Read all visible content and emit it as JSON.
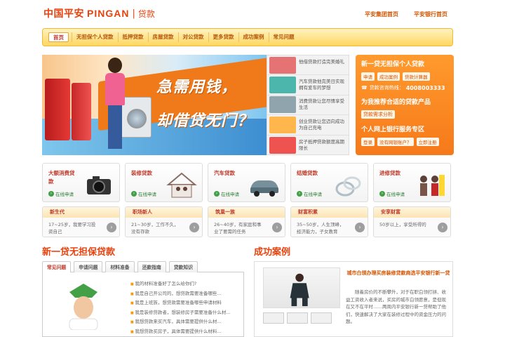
{
  "header": {
    "logo_cn": "中国平安",
    "logo_en": "PINGAN",
    "logo_sep": "|",
    "logo_sub": "贷款",
    "links": [
      "平安集团首页",
      "平安银行首页"
    ]
  },
  "nav": {
    "items": [
      "首页",
      "无担保个人贷款",
      "抵押贷款",
      "房屋贷款",
      "对公贷款",
      "更多贷款",
      "成功案例",
      "常见问题"
    ]
  },
  "banner": {
    "line1": "急需用钱，",
    "line2": "却借贷无门？"
  },
  "thumbs": [
    {
      "text": "他借贷款打造完美婚礼",
      "color": "#e57373"
    },
    {
      "text": "汽车贷款他完美日实现拥有爱车的梦想",
      "color": "#4db6ac"
    },
    {
      "text": "消费贷款让您尽情享受生活",
      "color": "#90a4ae"
    },
    {
      "text": "创业贷款让您迈向成功为自己充电",
      "color": "#ffb74d"
    },
    {
      "text": "房子抵押贷款额度高期限长",
      "color": "#ef5350"
    }
  ],
  "right_panel": {
    "title": "新一贷无担保个人贷款",
    "links": [
      "申请",
      "成功案例",
      "贷款计算器"
    ],
    "phone_label": "贷款咨询热线：",
    "phone": "4008003333",
    "recommend": "为我推荐合适的贷款产品",
    "recommend_link": "贷款需求分析",
    "bank_title": "个人网上银行服务专区",
    "bank_links": [
      "登录",
      "没有网银账户？",
      "立即注册"
    ]
  },
  "cards": [
    {
      "title": "大额消费贷款",
      "apply": "在线申请",
      "color": "#424242"
    },
    {
      "title": "装修贷款",
      "apply": "在线申请",
      "color": "#8d6e63"
    },
    {
      "title": "汽车贷款",
      "apply": "在线申请",
      "color": "#607d8b"
    },
    {
      "title": "结婚贷款",
      "apply": "在线申请",
      "color": "#b0bec5"
    },
    {
      "title": "进修贷款",
      "apply": "在线申请",
      "color": "#5d4037"
    }
  ],
  "segments": [
    {
      "title": "新生代",
      "text": "17~25岁，我要学习投资自己"
    },
    {
      "title": "职场新人",
      "text": "21~30岁，工作不久，没有存款"
    },
    {
      "title": "筑巢一族",
      "text": "26~40岁，有家庭和事业了要需的任务"
    },
    {
      "title": "财富积累",
      "text": "35~50岁，人生顶峰，经济能力，子女教育"
    },
    {
      "title": "安享财富",
      "text": "50岁以上，享受所得的"
    }
  ],
  "loan_section": {
    "title": "新一贷无担保贷款",
    "tabs": [
      "常见问题",
      "申请问题",
      "材料准备",
      "还款指南",
      "贷款知识"
    ],
    "faqs": [
      "我的材料准备好了怎么给你们?",
      "我是自己开公司的，想贷款需要准备哪些...",
      "我是上班族，想贷款需要准备哪些申请材料",
      "我是装修贷款者，想装修房子需要准备什么材...",
      "我想贷款来买汽车，具体需要提供什么材...",
      "我想贷款买房子，具体需要提供什么材料..."
    ]
  },
  "case_section": {
    "title": "成功案例",
    "case_title": "城市白领办理买房装修贷款商选平安银行新一贷",
    "case_text": "随着房价的不断攀升，对于在职白领打拼、收益工资收入者来说，买房的城市白领愿意，是但现在又不在平时……两周内平安银行新一贷帮助了他们，快速解决了大家在装修过程中的资金压力的问题。"
  }
}
